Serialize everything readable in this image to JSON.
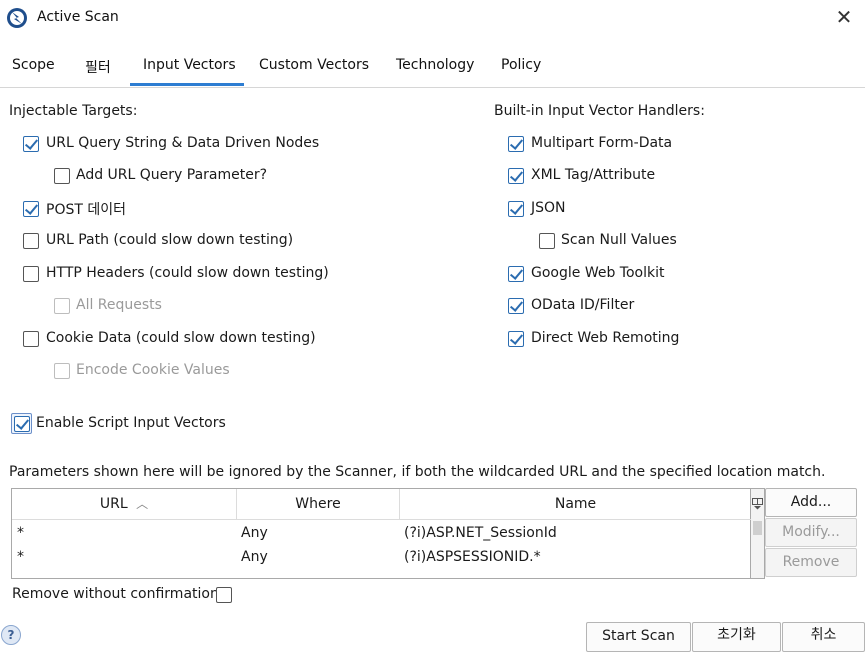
{
  "window": {
    "title": "Active Scan",
    "close_glyph": "✕",
    "app_icon": "zap-logo-icon"
  },
  "tabs": [
    {
      "label": "Scope",
      "active": false
    },
    {
      "label": "필터",
      "active": false
    },
    {
      "label": "Input Vectors",
      "active": true
    },
    {
      "label": "Custom Vectors",
      "active": false
    },
    {
      "label": "Technology",
      "active": false
    },
    {
      "label": "Policy",
      "active": false
    }
  ],
  "injectable": {
    "heading": "Injectable Targets:",
    "items": [
      {
        "label": "URL Query String & Data Driven Nodes",
        "checked": true,
        "enabled": true
      },
      {
        "label": "Add URL Query Parameter?",
        "checked": false,
        "enabled": true
      },
      {
        "label": "POST 데이터",
        "checked": true,
        "enabled": true
      },
      {
        "label": "URL Path (could slow down testing)",
        "checked": false,
        "enabled": true
      },
      {
        "label": "HTTP Headers (could slow down testing)",
        "checked": false,
        "enabled": true
      },
      {
        "label": "All Requests",
        "checked": false,
        "enabled": false
      },
      {
        "label": "Cookie Data (could slow down testing)",
        "checked": false,
        "enabled": true
      },
      {
        "label": "Encode Cookie Values",
        "checked": false,
        "enabled": false
      }
    ]
  },
  "builtin": {
    "heading": "Built-in Input Vector Handlers:",
    "items": [
      {
        "label": "Multipart Form-Data",
        "checked": true
      },
      {
        "label": "XML Tag/Attribute",
        "checked": true
      },
      {
        "label": "JSON",
        "checked": true
      },
      {
        "label": "Scan Null Values",
        "checked": false
      },
      {
        "label": "Google Web Toolkit",
        "checked": true
      },
      {
        "label": "OData ID/Filter",
        "checked": true
      },
      {
        "label": "Direct Web Remoting",
        "checked": true
      }
    ]
  },
  "script_vectors": {
    "label": "Enable Script Input Vectors",
    "checked": true
  },
  "params": {
    "description": "Parameters shown here will be ignored by the Scanner, if both the wildcarded URL and the specified location match.",
    "columns": [
      "URL",
      "Where",
      "Name"
    ],
    "sort_glyph": "︿",
    "rows": [
      {
        "url": "*",
        "where": "Any",
        "name": "(?i)ASP.NET_SessionId"
      },
      {
        "url": "*",
        "where": "Any",
        "name": "(?i)ASPSESSIONID.*"
      }
    ],
    "buttons": {
      "add": "Add...",
      "modify": "Modify...",
      "remove": "Remove"
    },
    "remove_without_confirm": {
      "label": "Remove without confirmation?",
      "checked": false
    }
  },
  "footer": {
    "start_scan": "Start Scan",
    "reset": "초기화",
    "cancel": "취소",
    "help_glyph": "?"
  }
}
